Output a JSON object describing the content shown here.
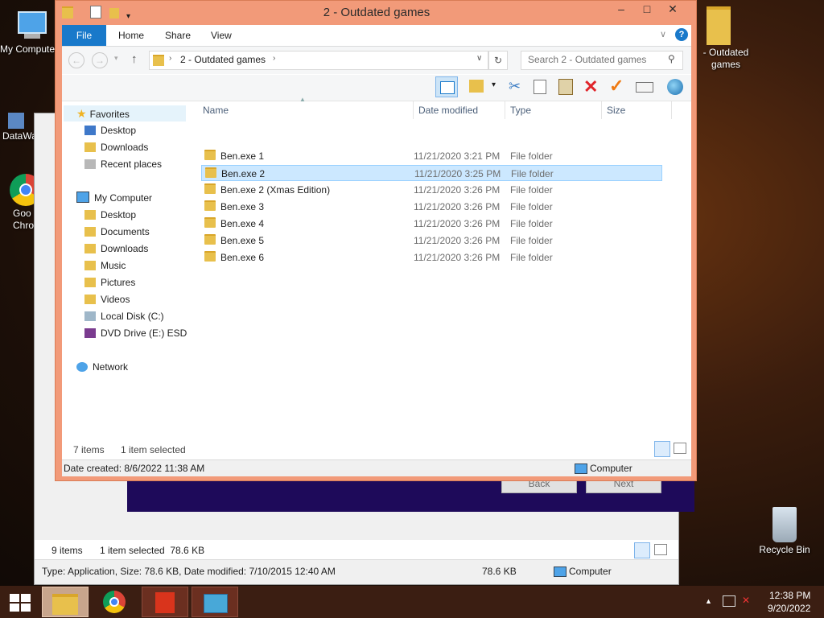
{
  "desktop": {
    "icons": [
      {
        "label": "My Computer"
      },
      {
        "label": "DataWa"
      },
      {
        "label": "Goo Chro"
      },
      {
        "label": "- Outdated games"
      },
      {
        "label": "Recycle Bin"
      }
    ]
  },
  "background_window": {
    "back_label": "Back",
    "next_label": "Next",
    "items_count": "9 items",
    "selected_info": "1 item selected  78.6 KB",
    "details": "Type: Application, Size: 78.6 KB, Date modified: 7/10/2015 12:40 AM",
    "size": "78.6 KB",
    "location": "Computer"
  },
  "window": {
    "title": "2 - Outdated games",
    "controls": {
      "minimize": "–",
      "maximize": "□",
      "close": "✕"
    },
    "ribbon_tabs": [
      "File",
      "Home",
      "Share",
      "View"
    ],
    "address": {
      "crumb": "2 - Outdated games"
    },
    "search": {
      "placeholder": "Search 2 - Outdated games"
    },
    "nav": {
      "favorites": "Favorites",
      "fav_items": [
        "Desktop",
        "Downloads",
        "Recent places"
      ],
      "computer": "My Computer",
      "comp_items": [
        "Desktop",
        "Documents",
        "Downloads",
        "Music",
        "Pictures",
        "Videos",
        "Local Disk (C:)",
        "DVD Drive (E:) ESD-IS"
      ],
      "network": "Network"
    },
    "columns": [
      "Name",
      "Date modified",
      "Type",
      "Size"
    ],
    "files": [
      {
        "name": "Ben.exe 1",
        "date": "11/21/2020 3:21 PM",
        "type": "File folder"
      },
      {
        "name": "Ben.exe 2",
        "date": "11/21/2020 3:25 PM",
        "type": "File folder"
      },
      {
        "name": "Ben.exe 2 (Xmas Edition)",
        "date": "11/21/2020 3:26 PM",
        "type": "File folder"
      },
      {
        "name": "Ben.exe 3",
        "date": "11/21/2020 3:26 PM",
        "type": "File folder"
      },
      {
        "name": "Ben.exe 4",
        "date": "11/21/2020 3:26 PM",
        "type": "File folder"
      },
      {
        "name": "Ben.exe 5",
        "date": "11/21/2020 3:26 PM",
        "type": "File folder"
      },
      {
        "name": "Ben.exe 6",
        "date": "11/21/2020 3:26 PM",
        "type": "File folder"
      }
    ],
    "status": {
      "items": "7 items",
      "selected": "1 item selected"
    },
    "details": {
      "created": "Date created: 8/6/2022 11:38 AM",
      "location": "Computer"
    }
  },
  "taskbar": {
    "time": "12:38 PM",
    "date": "9/20/2022"
  },
  "colors": {
    "title_bar": "#f29a79",
    "file_tab": "#1979ca",
    "selection": "#cce8ff"
  }
}
